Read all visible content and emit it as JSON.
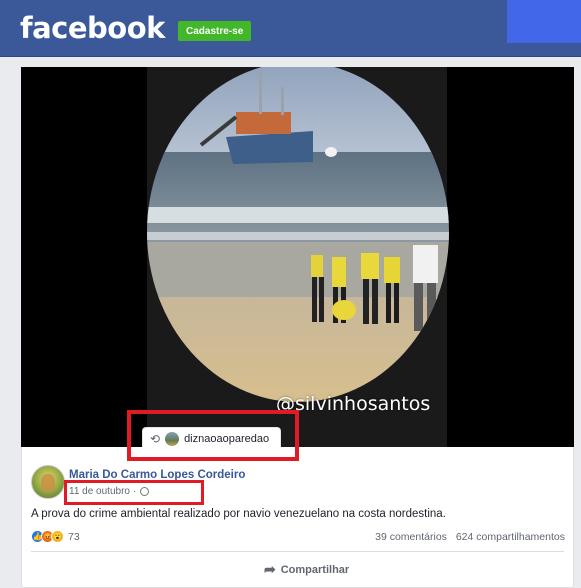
{
  "header": {
    "logo": "facebook",
    "signup_label": "Cadastre-se"
  },
  "video": {
    "watermark": "@silvinhosantos",
    "repost_username": "diznaoaoparedao"
  },
  "post": {
    "author": "Maria Do Carmo Lopes Cordeiro",
    "date": "11 de outubro",
    "separator": "·",
    "text": "A prova do crime ambiental realizado por navio venezuelano na costa nordestina.",
    "reaction_count": "73",
    "comments": "39 comentários",
    "shares": "624 compartilhamentos",
    "share_label": "Compartilhar"
  },
  "icons": {
    "repost": "repost-icon",
    "globe": "globe-icon",
    "share": "share-arrow-icon"
  },
  "colors": {
    "brand": "#3b5998",
    "signup": "#42b72a",
    "highlight": "#e01b24",
    "link": "#385898"
  }
}
